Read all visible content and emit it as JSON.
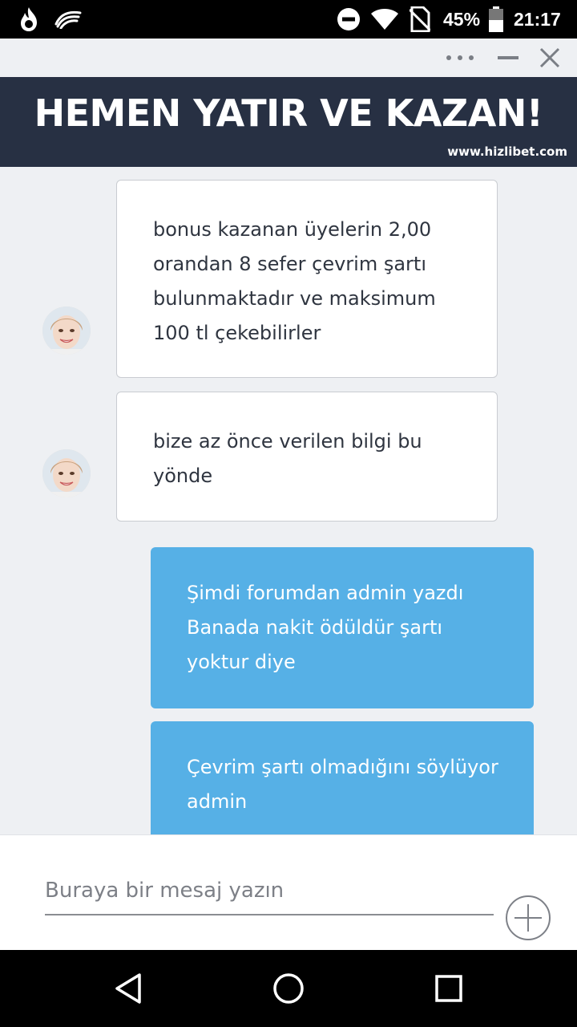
{
  "status_bar": {
    "battery": "45%",
    "time": "21:17",
    "icons": [
      "flame-app-icon",
      "swiftkey-icon",
      "do-not-disturb-icon",
      "wifi-icon",
      "no-sim-icon",
      "battery-icon"
    ]
  },
  "window": {
    "icons": [
      "more-icon",
      "minimize-icon",
      "close-icon"
    ]
  },
  "banner": {
    "title": "HEMEN YATIR VE KAZAN!",
    "url": "www.hizlibet.com",
    "background": "#273043"
  },
  "messages": [
    {
      "from": "agent",
      "lines": [
        "bonus kazanan üyelerin 2,00",
        "orandan 8 sefer çevrim şartı",
        "bulunmaktadır ve maksimum",
        "100 tl çekebilirler"
      ]
    },
    {
      "from": "agent",
      "lines": [
        "bize az önce verilen bilgi bu",
        "yönde"
      ]
    },
    {
      "from": "user",
      "lines": [
        "Şimdi forumdan admin yazdı",
        "Banada nakit ödüldür şartı",
        "yoktur diye"
      ]
    },
    {
      "from": "user",
      "lines": [
        "Çevrim şartı olmadığını söylüyor",
        "admin"
      ]
    }
  ],
  "colors": {
    "user_bubble": "#56b0e6",
    "agent_bubble": "#ffffff",
    "chat_background": "#eef0f3"
  },
  "composer": {
    "placeholder": "Buraya bir mesaj yazın",
    "value": ""
  },
  "nav": {
    "icons": [
      "back-icon",
      "home-icon",
      "recents-icon"
    ]
  }
}
